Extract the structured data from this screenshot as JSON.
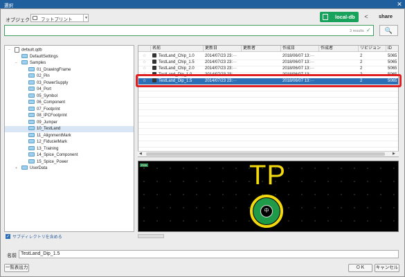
{
  "window": {
    "title": "選択",
    "close_icon": "✕"
  },
  "object": {
    "label": "オブジェクト",
    "value": "フットプリント"
  },
  "toolbar": {
    "localdb_label": "local-db",
    "share_label": "share",
    "share_icon": "<"
  },
  "search": {
    "value": "",
    "results_text": "3 results",
    "search_icon": "🔍"
  },
  "tree": [
    {
      "label": "default.qdb",
      "level": 0,
      "toggle": "−"
    },
    {
      "label": "DefaultSettings",
      "level": 1
    },
    {
      "label": "Samples",
      "level": 1,
      "toggle": "−"
    },
    {
      "label": "01_DrawingFrame",
      "level": 2
    },
    {
      "label": "02_Pin",
      "level": 2
    },
    {
      "label": "03_PowerSupply",
      "level": 2
    },
    {
      "label": "04_Port",
      "level": 2
    },
    {
      "label": "05_Symbol",
      "level": 2
    },
    {
      "label": "06_Component",
      "level": 2
    },
    {
      "label": "07_Footprint",
      "level": 2
    },
    {
      "label": "08_IPCFootprint",
      "level": 2
    },
    {
      "label": "09_Jumper",
      "level": 2
    },
    {
      "label": "10_TestLand",
      "level": 2,
      "selected": true
    },
    {
      "label": "11_AlignmentMark",
      "level": 2
    },
    {
      "label": "12_FiducielMark",
      "level": 2
    },
    {
      "label": "13_Training",
      "level": 2
    },
    {
      "label": "14_Spice_Component",
      "level": 2
    },
    {
      "label": "15_Spice_Power",
      "level": 2
    },
    {
      "label": "UserData",
      "level": 1,
      "toggle": "+"
    }
  ],
  "subdir": {
    "label": "サブディレクトリを含める",
    "checked": true
  },
  "table": {
    "headers": [
      "",
      "名前",
      "更新日",
      "更新者",
      "作成日",
      "作成者",
      "リビジョン",
      "ID"
    ],
    "rows": [
      {
        "star": "☆",
        "name": "TestLand_Chip_1.0",
        "updated": "2014/07/23 23:···",
        "updater": "",
        "created": "2018/06/07 13:···",
        "creator": "",
        "rev": "2",
        "id": "5065"
      },
      {
        "star": "☆",
        "name": "TestLand_Chip_1.5",
        "updated": "2014/07/23 23:···",
        "updater": "",
        "created": "2018/06/07 13:···",
        "creator": "",
        "rev": "2",
        "id": "5065"
      },
      {
        "star": "☆",
        "name": "TestLand_Chip_2.0",
        "updated": "2014/07/23 23:···",
        "updater": "",
        "created": "2018/06/07 13:···",
        "creator": "",
        "rev": "2",
        "id": "5065"
      },
      {
        "star": "☆",
        "name": "TestLand_Dip_1.0",
        "updated": "2014/07/23 23:···",
        "updater": "",
        "created": "2018/06/07 13:···",
        "creator": "",
        "rev": "2",
        "id": "5065"
      },
      {
        "star": "☆",
        "name": "TestLand_Dip_1.5",
        "updated": "2014/07/23 23:···",
        "updater": "",
        "created": "2018/06/07 13:···",
        "creator": "",
        "rev": "2",
        "id": "5065",
        "selected": true
      }
    ]
  },
  "preview": {
    "text": "TP",
    "pad_label": "中",
    "badge": "PCB"
  },
  "name_field": {
    "label": "名前",
    "value": "TestLand_Dip_1.5"
  },
  "buttons": {
    "export": "一覧表出力",
    "ok": "ＯＫ",
    "cancel": "キャンセル"
  },
  "colors": {
    "accent": "#19a25c",
    "selection": "#2d6fb7",
    "highlight": "#e02020",
    "pad_yellow": "#f2d80e"
  }
}
